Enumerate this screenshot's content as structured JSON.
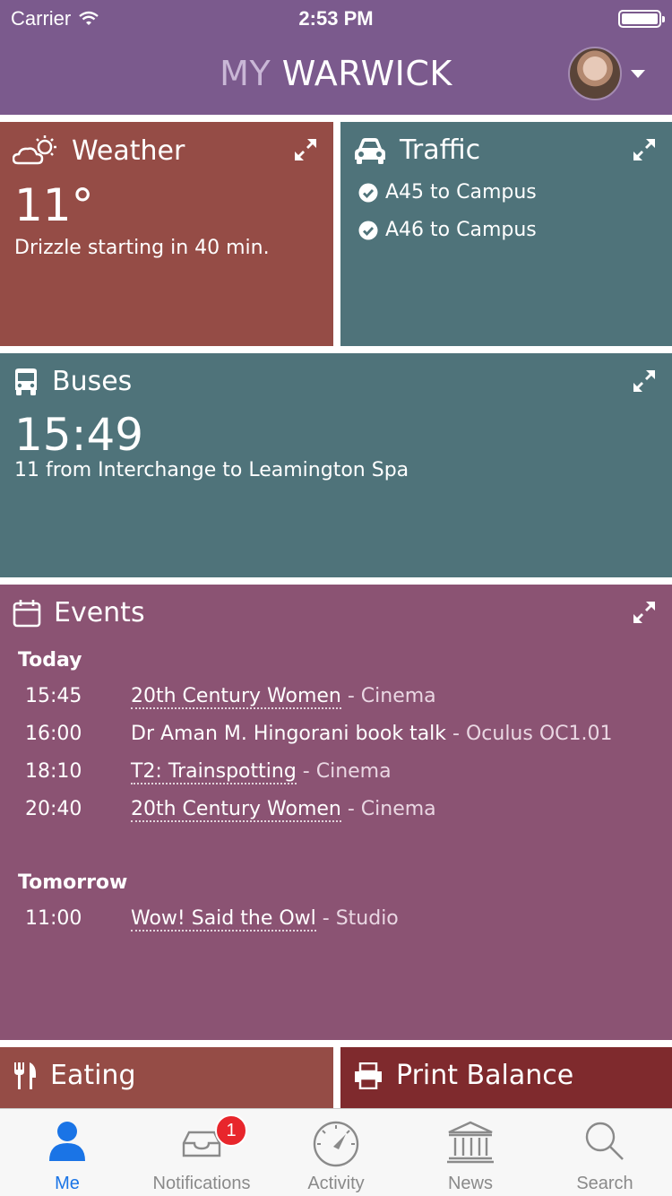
{
  "status_bar": {
    "carrier": "Carrier",
    "time": "2:53 PM"
  },
  "header": {
    "title_my": "MY",
    "title_brand": "WARWICK"
  },
  "weather": {
    "title": "Weather",
    "temperature": "11°",
    "description": "Drizzle starting in 40 min."
  },
  "traffic": {
    "title": "Traffic",
    "routes": [
      {
        "label": "A45 to Campus"
      },
      {
        "label": "A46 to Campus"
      }
    ]
  },
  "buses": {
    "title": "Buses",
    "time": "15:49",
    "description": "11 from Interchange to Leamington Spa"
  },
  "events": {
    "title": "Events",
    "days": [
      {
        "label": "Today",
        "items": [
          {
            "time": "15:45",
            "title": "20th Century Women",
            "venue": "- Cinema"
          },
          {
            "time": "16:00",
            "title": "Dr Aman M. Hingorani book talk",
            "venue": "- Oculus OC1.01"
          },
          {
            "time": "18:10",
            "title": "T2: Trainspotting",
            "venue": "- Cinema"
          },
          {
            "time": "20:40",
            "title": "20th Century Women",
            "venue": "- Cinema"
          }
        ]
      },
      {
        "label": "Tomorrow",
        "items": [
          {
            "time": "11:00",
            "title": "Wow! Said the Owl",
            "venue": "- Studio"
          }
        ]
      }
    ]
  },
  "eating": {
    "title": "Eating"
  },
  "print_balance": {
    "title": "Print Balance"
  },
  "tab_bar": {
    "items": [
      {
        "label": "Me",
        "icon": "person-icon"
      },
      {
        "label": "Notifications",
        "icon": "inbox-icon",
        "badge": "1"
      },
      {
        "label": "Activity",
        "icon": "gauge-icon"
      },
      {
        "label": "News",
        "icon": "building-icon"
      },
      {
        "label": "Search",
        "icon": "search-icon"
      }
    ],
    "active_index": 0
  },
  "colors": {
    "header": "#7b5a8d",
    "weather": "#954c46",
    "traffic": "#4f737a",
    "events": "#8b5373",
    "print": "#7f2a2d",
    "active_tab": "#1a74e6"
  }
}
